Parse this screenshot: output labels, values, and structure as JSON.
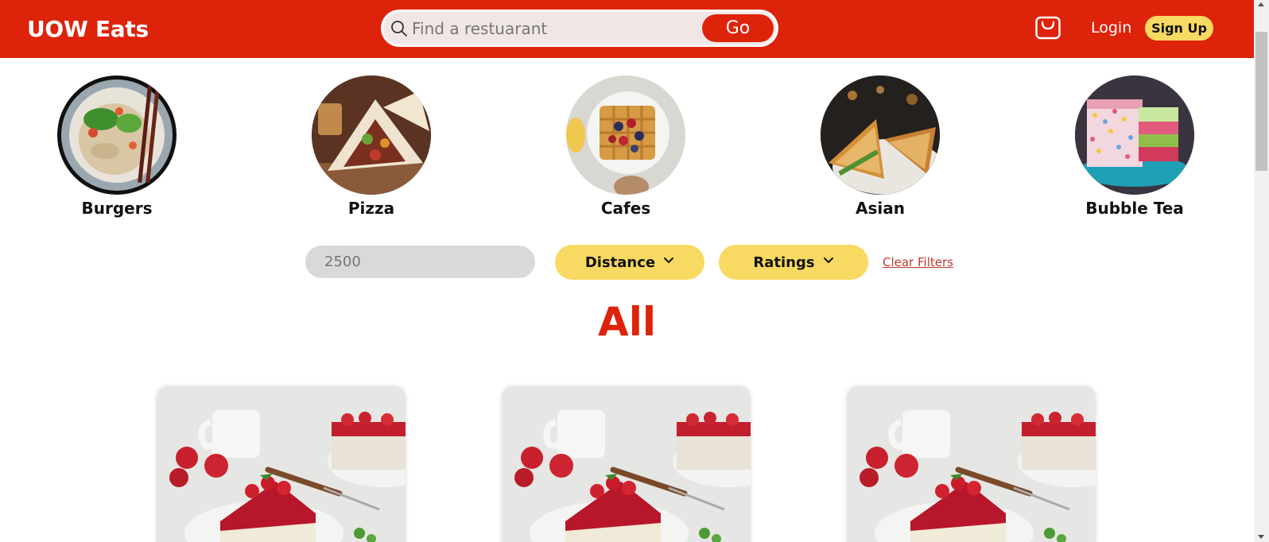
{
  "header": {
    "brand": "UOW Eats",
    "search": {
      "placeholder": "Find a restuarant",
      "button_label": "Go"
    },
    "login_label": "Login",
    "signup_label": "Sign Up"
  },
  "categories": [
    {
      "label": "Burgers",
      "icon": "noodle-bowl-image"
    },
    {
      "label": "Pizza",
      "icon": "wrap-image"
    },
    {
      "label": "Cafes",
      "icon": "waffle-image"
    },
    {
      "label": "Asian",
      "icon": "sandwich-image"
    },
    {
      "label": "Bubble Tea",
      "icon": "layer-cake-image"
    }
  ],
  "filters": {
    "distance_value": "2500",
    "distance_label": "Distance",
    "ratings_label": "Ratings",
    "clear_label": "Clear Filters"
  },
  "section": {
    "title": "All"
  },
  "cards": [
    {
      "image": "strawberry-cheesecake-image"
    },
    {
      "image": "strawberry-cheesecake-image"
    },
    {
      "image": "strawberry-cheesecake-image"
    }
  ],
  "colors": {
    "brand_red": "#de230b",
    "accent_yellow": "#f8d961",
    "input_gray": "#d9d9d9"
  }
}
